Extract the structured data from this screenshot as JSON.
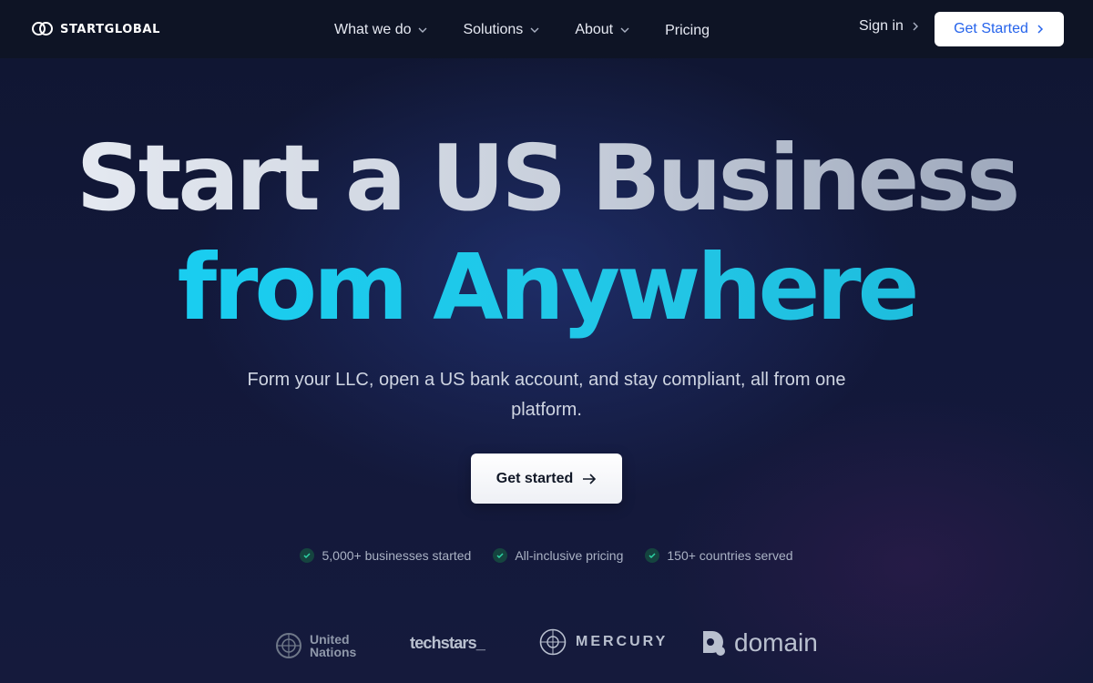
{
  "brand": {
    "name": "STARTGLOBAL",
    "icon": "interlocking-rings-logo"
  },
  "nav": {
    "items": [
      {
        "label": "What we do",
        "has_dropdown": true
      },
      {
        "label": "Solutions",
        "has_dropdown": true
      },
      {
        "label": "About",
        "has_dropdown": true
      },
      {
        "label": "Pricing",
        "has_dropdown": false
      }
    ],
    "signin_label": "Sign in",
    "cta_label": "Get Started"
  },
  "hero": {
    "title_line1": "Start a US Business",
    "title_line2": "from Anywhere",
    "subtitle": "Form your LLC, open a US bank account, and stay compliant, all from one platform.",
    "cta_label": "Get started",
    "cta_icon": "arrow-right-icon"
  },
  "features": [
    {
      "label": "5,000+ businesses started",
      "icon": "check-icon"
    },
    {
      "label": "All-inclusive pricing",
      "icon": "check-icon"
    },
    {
      "label": "150+ countries served",
      "icon": "check-icon"
    }
  ],
  "partners": {
    "un": {
      "line1": "United",
      "line2": "Nations"
    },
    "techstars": "techstars_",
    "mercury": "MERCURY",
    "domain": "domain"
  },
  "colors": {
    "background": "#12183a",
    "nav_background": "#0e1425",
    "accent_cyan": "#16d0f4",
    "button_blue_text": "#2563eb",
    "check_green": "#15443f"
  }
}
